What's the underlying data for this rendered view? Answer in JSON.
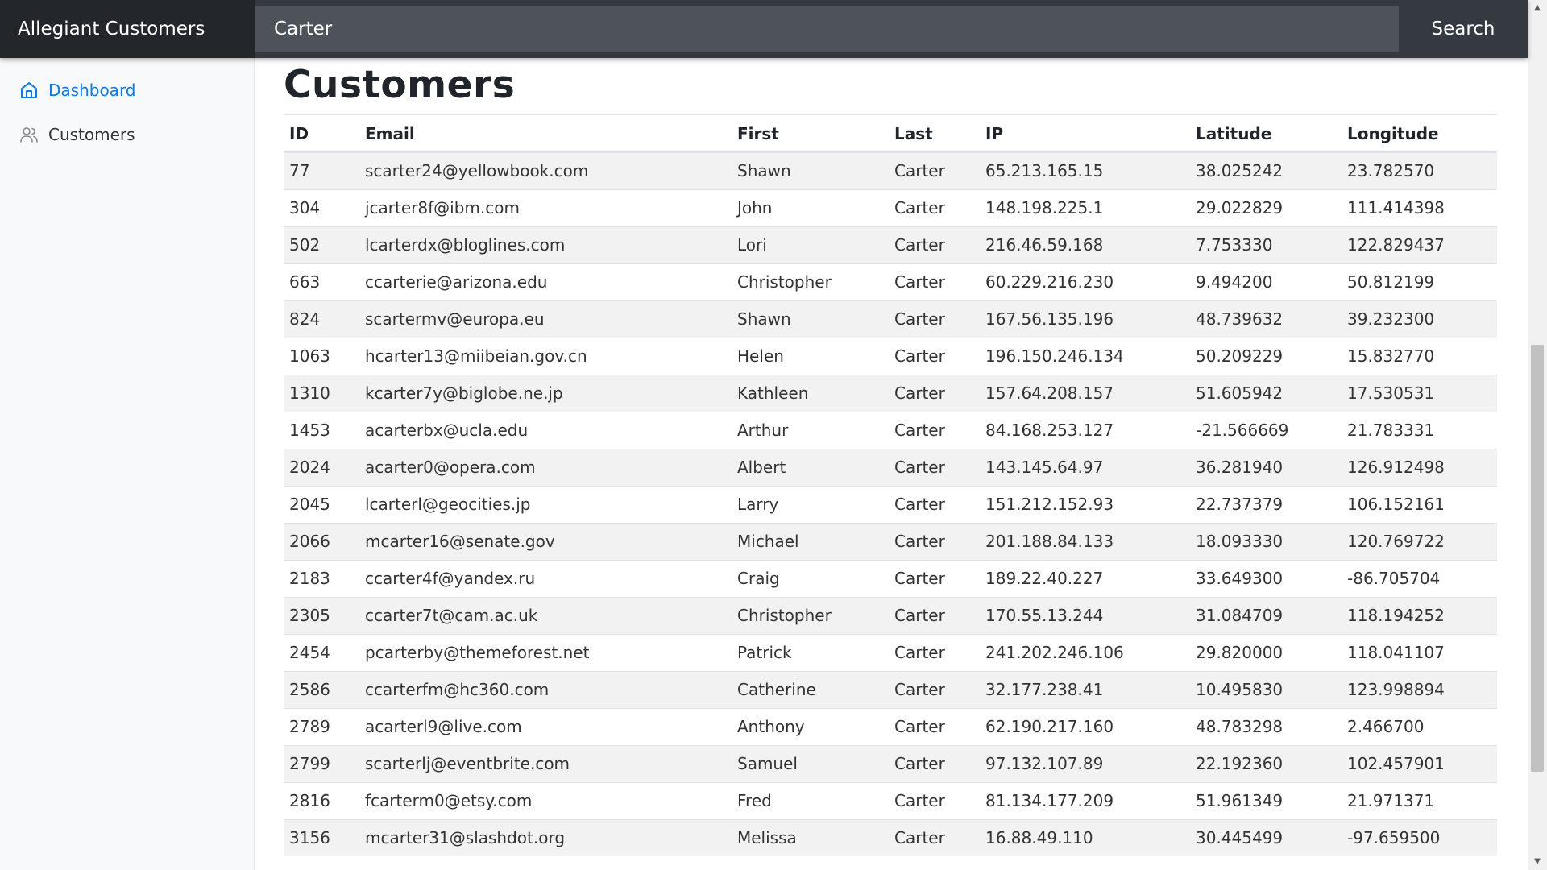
{
  "brand": "Allegiant Customers",
  "search": {
    "value": "Carter",
    "button_label": "Search"
  },
  "sidebar": {
    "items": [
      {
        "label": "Dashboard",
        "icon": "home-icon",
        "active": true
      },
      {
        "label": "Customers",
        "icon": "users-icon",
        "active": false
      }
    ]
  },
  "main": {
    "title": "Customers",
    "columns": [
      "ID",
      "Email",
      "First",
      "Last",
      "IP",
      "Latitude",
      "Longitude"
    ],
    "rows": [
      [
        "77",
        "scarter24@yellowbook.com",
        "Shawn",
        "Carter",
        "65.213.165.15",
        "38.025242",
        "23.782570"
      ],
      [
        "304",
        "jcarter8f@ibm.com",
        "John",
        "Carter",
        "148.198.225.1",
        "29.022829",
        "111.414398"
      ],
      [
        "502",
        "lcarterdx@bloglines.com",
        "Lori",
        "Carter",
        "216.46.59.168",
        "7.753330",
        "122.829437"
      ],
      [
        "663",
        "ccarterie@arizona.edu",
        "Christopher",
        "Carter",
        "60.229.216.230",
        "9.494200",
        "50.812199"
      ],
      [
        "824",
        "scartermv@europa.eu",
        "Shawn",
        "Carter",
        "167.56.135.196",
        "48.739632",
        "39.232300"
      ],
      [
        "1063",
        "hcarter13@miibeian.gov.cn",
        "Helen",
        "Carter",
        "196.150.246.134",
        "50.209229",
        "15.832770"
      ],
      [
        "1310",
        "kcarter7y@biglobe.ne.jp",
        "Kathleen",
        "Carter",
        "157.64.208.157",
        "51.605942",
        "17.530531"
      ],
      [
        "1453",
        "acarterbx@ucla.edu",
        "Arthur",
        "Carter",
        "84.168.253.127",
        "-21.566669",
        "21.783331"
      ],
      [
        "2024",
        "acarter0@opera.com",
        "Albert",
        "Carter",
        "143.145.64.97",
        "36.281940",
        "126.912498"
      ],
      [
        "2045",
        "lcarterl@geocities.jp",
        "Larry",
        "Carter",
        "151.212.152.93",
        "22.737379",
        "106.152161"
      ],
      [
        "2066",
        "mcarter16@senate.gov",
        "Michael",
        "Carter",
        "201.188.84.133",
        "18.093330",
        "120.769722"
      ],
      [
        "2183",
        "ccarter4f@yandex.ru",
        "Craig",
        "Carter",
        "189.22.40.227",
        "33.649300",
        "-86.705704"
      ],
      [
        "2305",
        "ccarter7t@cam.ac.uk",
        "Christopher",
        "Carter",
        "170.55.13.244",
        "31.084709",
        "118.194252"
      ],
      [
        "2454",
        "pcarterby@themeforest.net",
        "Patrick",
        "Carter",
        "241.202.246.106",
        "29.820000",
        "118.041107"
      ],
      [
        "2586",
        "ccarterfm@hc360.com",
        "Catherine",
        "Carter",
        "32.177.238.41",
        "10.495830",
        "123.998894"
      ],
      [
        "2789",
        "acarterl9@live.com",
        "Anthony",
        "Carter",
        "62.190.217.160",
        "48.783298",
        "2.466700"
      ],
      [
        "2799",
        "scarterlj@eventbrite.com",
        "Samuel",
        "Carter",
        "97.132.107.89",
        "22.192360",
        "102.457901"
      ],
      [
        "2816",
        "fcarterm0@etsy.com",
        "Fred",
        "Carter",
        "81.134.177.209",
        "51.961349",
        "21.971371"
      ],
      [
        "3156",
        "mcarter31@slashdot.org",
        "Melissa",
        "Carter",
        "16.88.49.110",
        "30.445499",
        "-97.659500"
      ]
    ]
  },
  "colors": {
    "navbar": "#343a40",
    "brand_bg": "#23272b",
    "accent": "#007bff",
    "stripe": "#f2f2f2"
  }
}
